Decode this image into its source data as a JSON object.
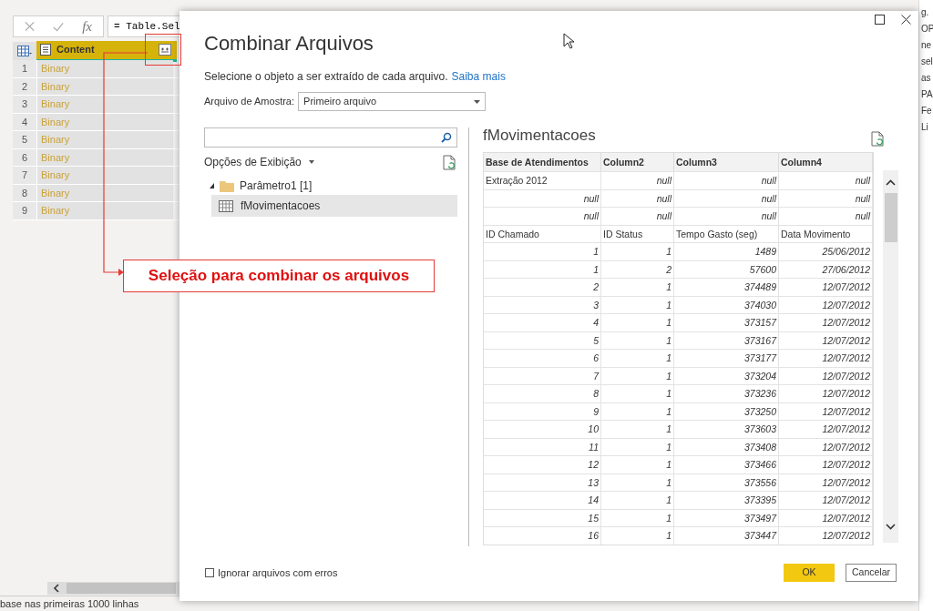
{
  "formula_bar": {
    "function_symbol": "fx",
    "formula": "= Table.Sel"
  },
  "query_table": {
    "column": "Content",
    "rows": [
      {
        "number": "1",
        "value": "Binary"
      },
      {
        "number": "2",
        "value": "Binary"
      },
      {
        "number": "3",
        "value": "Binary"
      },
      {
        "number": "4",
        "value": "Binary"
      },
      {
        "number": "5",
        "value": "Binary"
      },
      {
        "number": "6",
        "value": "Binary"
      },
      {
        "number": "7",
        "value": "Binary"
      },
      {
        "number": "8",
        "value": "Binary"
      },
      {
        "number": "9",
        "value": "Binary"
      }
    ]
  },
  "right_panel_fragments": [
    "g.",
    "OP",
    "ne",
    "sel",
    "as",
    "PA",
    "Fe",
    "Li"
  ],
  "status_bar": "base nas primeiras 1000 linhas",
  "callout": "Seleção para combinar os arquivos",
  "dialog": {
    "title": "Combinar Arquivos",
    "subtitle": "Selecione o objeto a ser extraído de cada arquivo.",
    "link": "Saiba mais",
    "sample_label": "Arquivo de Amostra:",
    "sample_value": "Primeiro arquivo",
    "display_options": "Opções de Exibição",
    "tree": [
      {
        "label": "Parâmetro1 [1]",
        "expanded": true,
        "selected": false,
        "children": [
          {
            "label": "fMovimentacoes",
            "selected": true
          }
        ]
      }
    ],
    "preview": {
      "title": "fMovimentacoes",
      "columns": [
        "Base de Atendimentos",
        "Column2",
        "Column3",
        "Column4"
      ],
      "rows": [
        {
          "kind": "mixed",
          "cells": [
            "Extração 2012",
            "null",
            "null",
            "null"
          ]
        },
        {
          "kind": "values",
          "cells": [
            "null",
            "null",
            "null",
            "null"
          ]
        },
        {
          "kind": "values",
          "cells": [
            "null",
            "null",
            "null",
            "null"
          ]
        },
        {
          "kind": "labels",
          "cells": [
            "ID Chamado",
            "ID Status",
            "Tempo Gasto (seg)",
            "Data Movimento"
          ]
        },
        {
          "kind": "values",
          "cells": [
            "1",
            "1",
            "1489",
            "25/06/2012"
          ]
        },
        {
          "kind": "values",
          "cells": [
            "1",
            "2",
            "57600",
            "27/06/2012"
          ]
        },
        {
          "kind": "values",
          "cells": [
            "2",
            "1",
            "374489",
            "12/07/2012"
          ]
        },
        {
          "kind": "values",
          "cells": [
            "3",
            "1",
            "374030",
            "12/07/2012"
          ]
        },
        {
          "kind": "values",
          "cells": [
            "4",
            "1",
            "373157",
            "12/07/2012"
          ]
        },
        {
          "kind": "values",
          "cells": [
            "5",
            "1",
            "373167",
            "12/07/2012"
          ]
        },
        {
          "kind": "values",
          "cells": [
            "6",
            "1",
            "373177",
            "12/07/2012"
          ]
        },
        {
          "kind": "values",
          "cells": [
            "7",
            "1",
            "373204",
            "12/07/2012"
          ]
        },
        {
          "kind": "values",
          "cells": [
            "8",
            "1",
            "373236",
            "12/07/2012"
          ]
        },
        {
          "kind": "values",
          "cells": [
            "9",
            "1",
            "373250",
            "12/07/2012"
          ]
        },
        {
          "kind": "values",
          "cells": [
            "10",
            "1",
            "373603",
            "12/07/2012"
          ]
        },
        {
          "kind": "values",
          "cells": [
            "11",
            "1",
            "373408",
            "12/07/2012"
          ]
        },
        {
          "kind": "values",
          "cells": [
            "12",
            "1",
            "373466",
            "12/07/2012"
          ]
        },
        {
          "kind": "values",
          "cells": [
            "13",
            "1",
            "373556",
            "12/07/2012"
          ]
        },
        {
          "kind": "values",
          "cells": [
            "14",
            "1",
            "373395",
            "12/07/2012"
          ]
        },
        {
          "kind": "values",
          "cells": [
            "15",
            "1",
            "373497",
            "12/07/2012"
          ]
        },
        {
          "kind": "values",
          "cells": [
            "16",
            "1",
            "373447",
            "12/07/2012"
          ]
        }
      ]
    },
    "ignore_errors": {
      "label": "Ignorar arquivos com erros",
      "checked": false
    },
    "buttons": [
      {
        "label": "OK",
        "kind": "primary"
      },
      {
        "label": "Cancelar",
        "kind": "secondary"
      }
    ]
  }
}
